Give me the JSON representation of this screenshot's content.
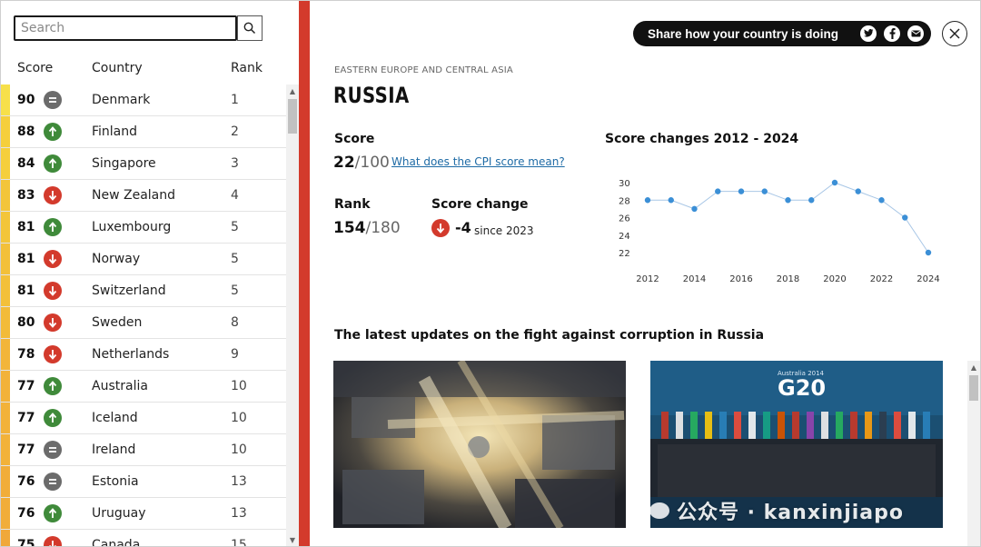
{
  "search": {
    "placeholder": "Search"
  },
  "table": {
    "headers": {
      "score": "Score",
      "country": "Country",
      "rank": "Rank"
    },
    "rows": [
      {
        "score": "90",
        "trend": "same",
        "country": "Denmark",
        "rank": "1",
        "stripe": "#f7e04a"
      },
      {
        "score": "88",
        "trend": "up",
        "country": "Finland",
        "rank": "2",
        "stripe": "#f5cf3c"
      },
      {
        "score": "84",
        "trend": "up",
        "country": "Singapore",
        "rank": "3",
        "stripe": "#f5cf3c"
      },
      {
        "score": "83",
        "trend": "down",
        "country": "New Zealand",
        "rank": "4",
        "stripe": "#f3c53a"
      },
      {
        "score": "81",
        "trend": "up",
        "country": "Luxembourg",
        "rank": "5",
        "stripe": "#f3c53a"
      },
      {
        "score": "81",
        "trend": "down",
        "country": "Norway",
        "rank": "5",
        "stripe": "#f3c03a"
      },
      {
        "score": "81",
        "trend": "down",
        "country": "Switzerland",
        "rank": "5",
        "stripe": "#f3c03a"
      },
      {
        "score": "80",
        "trend": "down",
        "country": "Sweden",
        "rank": "8",
        "stripe": "#f2bb39"
      },
      {
        "score": "78",
        "trend": "down",
        "country": "Netherlands",
        "rank": "9",
        "stripe": "#f2b53a"
      },
      {
        "score": "77",
        "trend": "up",
        "country": "Australia",
        "rank": "10",
        "stripe": "#f2b23a"
      },
      {
        "score": "77",
        "trend": "up",
        "country": "Iceland",
        "rank": "10",
        "stripe": "#f2b23a"
      },
      {
        "score": "77",
        "trend": "same",
        "country": "Ireland",
        "rank": "10",
        "stripe": "#f2b23a"
      },
      {
        "score": "76",
        "trend": "same",
        "country": "Estonia",
        "rank": "13",
        "stripe": "#f1ad3a"
      },
      {
        "score": "76",
        "trend": "up",
        "country": "Uruguay",
        "rank": "13",
        "stripe": "#f1ad3a"
      },
      {
        "score": "75",
        "trend": "down",
        "country": "Canada",
        "rank": "15",
        "stripe": "#f0a83a"
      }
    ]
  },
  "share": {
    "label": "Share how your country is doing",
    "icons": [
      "twitter-icon",
      "facebook-icon",
      "email-icon"
    ]
  },
  "detail": {
    "region": "EASTERN EUROPE AND CENTRAL ASIA",
    "country": "RUSSIA",
    "score_label": "Score",
    "score_value": "22",
    "score_max": "/100",
    "cpi_link": "What does the CPI score mean?",
    "rank_label": "Rank",
    "rank_value": "154",
    "rank_max": "/180",
    "change_label": "Score change",
    "change_value": "-4",
    "change_since": "since 2023",
    "updates_title": "The latest updates on the fight against corruption in Russia",
    "photo2_caption": "Australia 2014"
  },
  "watermark": "公众号 · kanxinjiapo",
  "colors": {
    "accent_red": "#d33a2c",
    "up_green": "#3f8a3a",
    "down_red": "#d33a2c",
    "same_gray": "#6b6b6b",
    "point_blue": "#3b8fd6"
  },
  "chart_data": {
    "type": "line",
    "title": "Score changes 2012 - 2024",
    "x": [
      2012,
      2013,
      2014,
      2015,
      2016,
      2017,
      2018,
      2019,
      2020,
      2021,
      2022,
      2023,
      2024
    ],
    "y": [
      28,
      28,
      27,
      29,
      29,
      29,
      28,
      28,
      30,
      29,
      28,
      26,
      22
    ],
    "x_ticks": [
      "2012",
      "2014",
      "2016",
      "2018",
      "2020",
      "2022",
      "2024"
    ],
    "y_ticks": [
      "30",
      "28",
      "26",
      "24",
      "22"
    ],
    "ylim": [
      22,
      30
    ],
    "grid": false
  }
}
